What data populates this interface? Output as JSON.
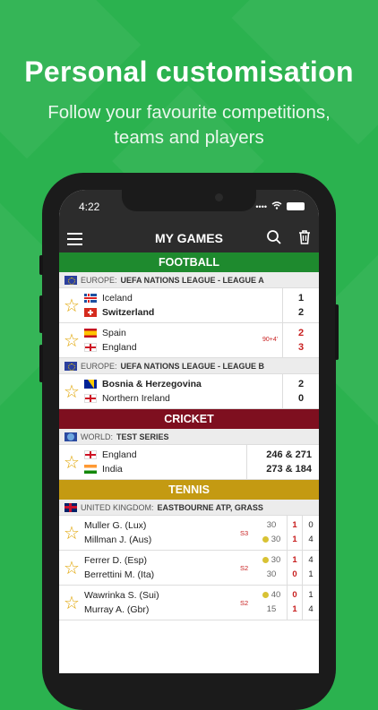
{
  "headline": "Personal customisation",
  "subheadline_1": "Follow your favourite competitions,",
  "subheadline_2": "teams and players",
  "status": {
    "time": "4:22"
  },
  "appbar": {
    "title": "MY GAMES"
  },
  "colors": {
    "football": "#1e8a2e",
    "cricket": "#7e0f1f",
    "tennis": "#c49a12"
  },
  "sections": {
    "football": {
      "label": "FOOTBALL",
      "competitions": [
        {
          "region": "EUROPE:",
          "name": "UEFA NATIONS LEAGUE - LEAGUE A",
          "matches": [
            {
              "home": "Iceland",
              "away": "Switzerland",
              "home_score": "1",
              "away_score": "2",
              "extra": ""
            },
            {
              "home": "Spain",
              "away": "England",
              "home_score": "2",
              "away_score": "3",
              "extra": "90+4'"
            }
          ]
        },
        {
          "region": "EUROPE:",
          "name": "UEFA NATIONS LEAGUE - LEAGUE B",
          "matches": [
            {
              "home": "Bosnia & Herzegovina",
              "away": "Northern Ireland",
              "home_score": "2",
              "away_score": "0",
              "extra": ""
            }
          ]
        }
      ]
    },
    "cricket": {
      "label": "CRICKET",
      "region": "WORLD:",
      "name": "TEST SERIES",
      "match": {
        "home": "England",
        "away": "India",
        "home_score": "246 & 271",
        "away_score": "273 & 184"
      }
    },
    "tennis": {
      "label": "TENNIS",
      "region": "UNITED KINGDOM:",
      "name": "EASTBOURNE ATP, GRASS",
      "matches": [
        {
          "p1": "Muller G. (Lux)",
          "p2": "Millman J. (Aus)",
          "set": "S3",
          "p1_pts": "30",
          "p2_pts": "30",
          "p1_sets": "1",
          "p2_sets": "1",
          "p1_games": "0",
          "p2_games": "4"
        },
        {
          "p1": "Ferrer D. (Esp)",
          "p2": "Berrettini M. (Ita)",
          "set": "S2",
          "p1_pts": "30",
          "p2_pts": "30",
          "p1_sets": "1",
          "p2_sets": "0",
          "p1_games": "4",
          "p2_games": "1"
        },
        {
          "p1": "Wawrinka S. (Sui)",
          "p2": "Murray A. (Gbr)",
          "set": "S2",
          "p1_pts": "40",
          "p2_pts": "15",
          "p1_sets": "0",
          "p2_sets": "1",
          "p1_games": "1",
          "p2_games": "4"
        }
      ]
    }
  }
}
